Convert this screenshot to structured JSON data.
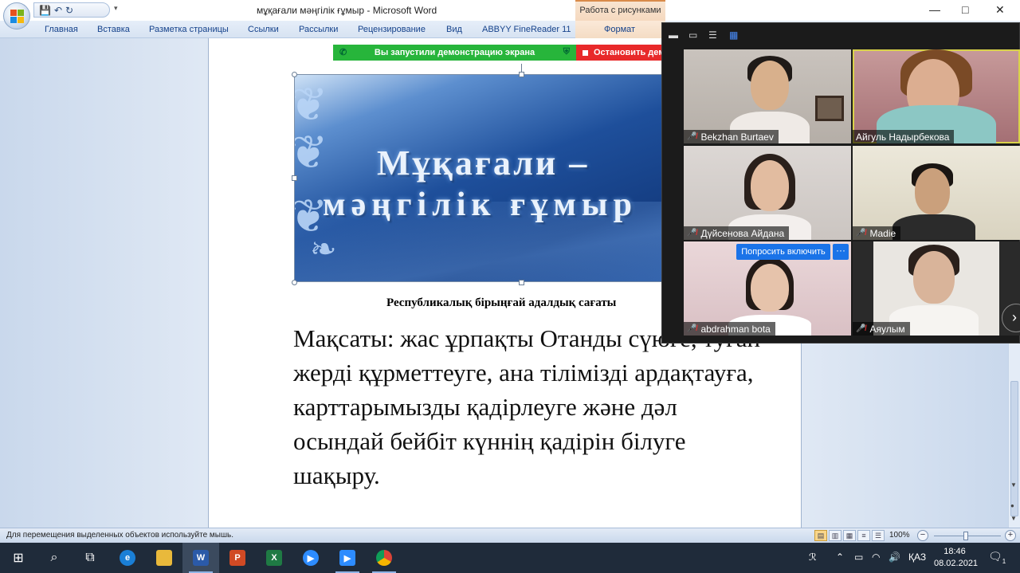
{
  "window": {
    "title": "мұқағали мәңгілік ғұмыр - Microsoft Word",
    "context_tab": "Работа с рисунками",
    "controls": {
      "minimize": "—",
      "maximize": "□",
      "close": "✕"
    }
  },
  "qat": {
    "save": "💾",
    "undo": "↶",
    "redo": "↻",
    "more": "▾"
  },
  "ribbon": {
    "tabs": [
      "Главная",
      "Вставка",
      "Разметка страницы",
      "Ссылки",
      "Рассылки",
      "Рецензирование",
      "Вид",
      "ABBYY FineReader 11",
      "Формат"
    ]
  },
  "share": {
    "status": "Вы запустили демонстрацию экрана",
    "stop": "Остановить демонстрацию"
  },
  "document": {
    "image_title_line1": "Мұқағали –",
    "image_title_line2": "мәңгілік  ғұмыр",
    "caption": "Республикалық бірыңғай адалдық сағаты",
    "body": "Мақсаты:  жас ұрпақты Отанды сүюге, туған жерді құрметтеуге, ана тілімізді ардақтауға, карттарымызды қадірлеуге және дәл осындай бейбіт күннің қадірін білуге шақыру."
  },
  "zoom": {
    "participants": [
      {
        "name": "Bekzhan Burtaev",
        "muted": true,
        "active": false
      },
      {
        "name": "Айгуль Надырбекова",
        "muted": false,
        "active": true
      },
      {
        "name": "Дүйсенова Айдана",
        "muted": true,
        "active": false
      },
      {
        "name": "Madie",
        "muted": true,
        "active": false
      },
      {
        "name": "abdrahman bota",
        "muted": true,
        "active": false
      },
      {
        "name": "Аяулым",
        "muted": true,
        "active": false
      }
    ],
    "ask_unmute": "Попросить включить",
    "more": "···",
    "next": "›"
  },
  "statusbar": {
    "text": "Для перемещения выделенных объектов используйте мышь.",
    "zoom": "100%",
    "minus": "−",
    "plus": "+"
  },
  "taskbar": {
    "lang": "ҚАЗ",
    "time": "18:46",
    "date": "08.02.2021",
    "notifications": "1"
  }
}
